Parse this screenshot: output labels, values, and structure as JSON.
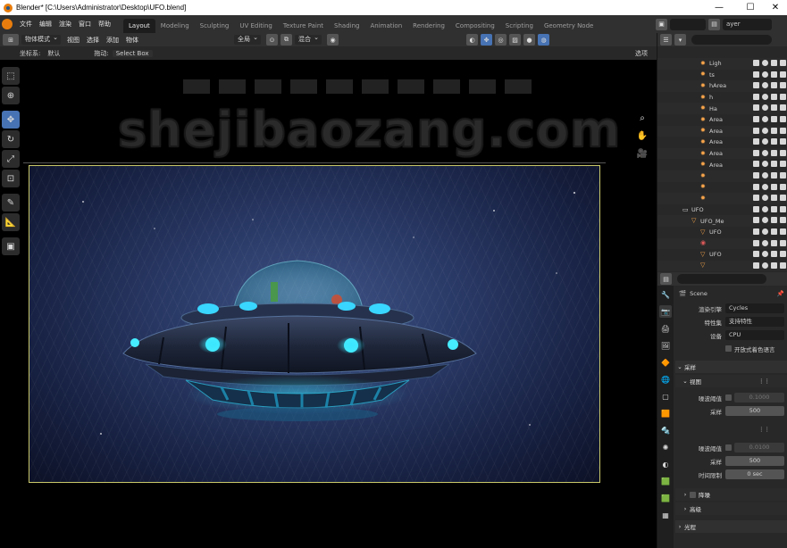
{
  "window": {
    "title": "Blender* [C:\\Users\\Administrator\\Desktop\\UFO.blend]",
    "minimize": "—",
    "maximize": "☐",
    "close": "✕"
  },
  "menu": {
    "items": [
      "文件",
      "编辑",
      "渲染",
      "窗口",
      "帮助"
    ]
  },
  "workspaces": [
    "Layout",
    "Modeling",
    "Sculpting",
    "UV Editing",
    "Texture Paint",
    "Shading",
    "Animation",
    "Rendering",
    "Compositing",
    "Scripting",
    "Geometry Node"
  ],
  "scene_area": {
    "scene_label": "ayer"
  },
  "viewport_header": {
    "mode": "物体模式",
    "view": "视图",
    "select": "选择",
    "add": "添加",
    "object": "物体",
    "transform_orientation": "全局",
    "blend": "混合"
  },
  "viewport_sub": {
    "coord_label": "坐标系:",
    "coord_value": "默认",
    "drag_label": "拖动:",
    "drag_value": "Select Box",
    "options": "选项"
  },
  "watermark": "shejibaozang.com",
  "outliner": {
    "rows": [
      {
        "name": "Ligh",
        "kind": "light"
      },
      {
        "name": "ts",
        "kind": "light"
      },
      {
        "name": "hArea",
        "kind": "light"
      },
      {
        "name": "h",
        "kind": "light"
      },
      {
        "name": "Ha",
        "kind": "light"
      },
      {
        "name": "Area",
        "kind": "light"
      },
      {
        "name": "Area",
        "kind": "light"
      },
      {
        "name": "Area",
        "kind": "light"
      },
      {
        "name": "Area",
        "kind": "light"
      },
      {
        "name": "Area",
        "kind": "light"
      },
      {
        "name": "",
        "kind": "light"
      },
      {
        "name": "",
        "kind": "light"
      },
      {
        "name": "",
        "kind": "light"
      },
      {
        "name": "UFO",
        "kind": "collection"
      },
      {
        "name": "UFO_Me",
        "kind": "mesh"
      },
      {
        "name": "UFO",
        "kind": "mesh"
      },
      {
        "name": "",
        "kind": "material"
      },
      {
        "name": "UFO",
        "kind": "mesh"
      },
      {
        "name": "",
        "kind": "mesh"
      }
    ]
  },
  "properties": {
    "scene_name": "Scene",
    "render_engine_label": "渲染引擎",
    "render_engine_value": "Cycles",
    "feature_set_label": "特性集",
    "feature_set_value": "支持特性",
    "device_label": "设备",
    "device_value": "CPU",
    "osl_label": "开放式着色语言",
    "sampling_section": "采样",
    "viewport_section": "视图",
    "noise_threshold_label": "噪波阈值",
    "noise_threshold_value_1": "0.1000",
    "samples_label": "采样",
    "samples_value_1": "500",
    "noise_threshold_value_2": "0.0100",
    "samples_value_2": "500",
    "time_limit_label": "时间限制",
    "time_limit_value": "0 sec",
    "denoise_label": "降噪",
    "advanced_label": "高级",
    "light_paths_label": "光程"
  },
  "colors": {
    "accent": "#4772b3",
    "frame_border": "#c9c96a",
    "blender_orange": "#e87d0d"
  }
}
